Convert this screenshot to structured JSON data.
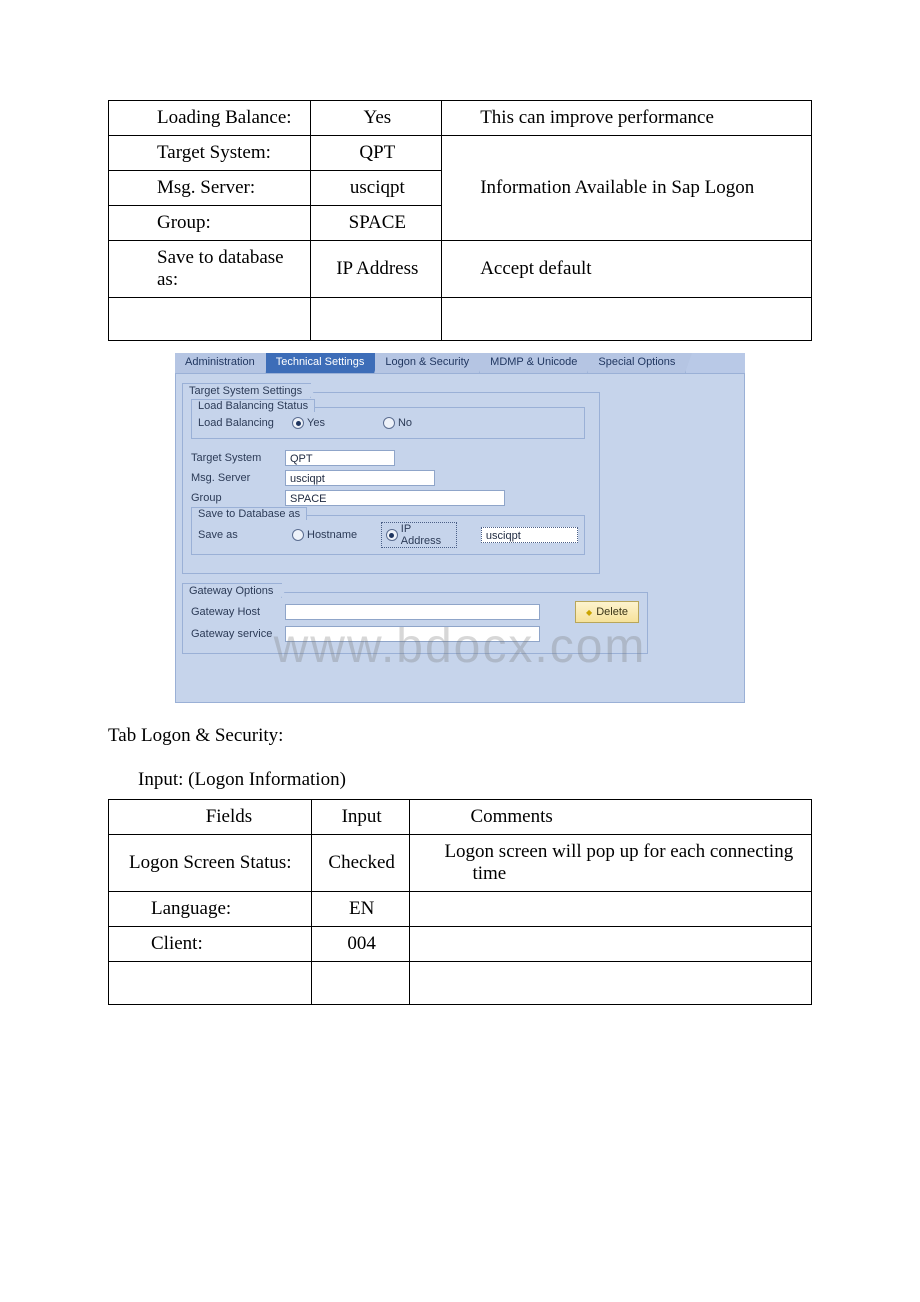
{
  "table1": {
    "rows": [
      {
        "field": "Loading Balance:",
        "input": "Yes",
        "comment": "This can improve performance"
      },
      {
        "field": "Target System:",
        "input": "QPT",
        "comment": "Information Available in Sap Logon"
      },
      {
        "field": "Msg. Server:",
        "input": "usciqpt"
      },
      {
        "field": "Group:",
        "input": "SPACE"
      },
      {
        "field": "Save to database as:",
        "input": "IP Address",
        "comment": "Accept default"
      }
    ]
  },
  "sap": {
    "tabs": {
      "admin": "Administration",
      "tech": "Technical Settings",
      "logon": "Logon & Security",
      "mdmp": "MDMP & Unicode",
      "spec": "Special Options"
    },
    "targetGroupTitle": "Target System Settings",
    "lbSubTitle": "Load Balancing Status",
    "lbLabel": "Load Balancing",
    "lbYes": "Yes",
    "lbNo": "No",
    "targetSystemLabel": "Target System",
    "targetSystemVal": "QPT",
    "msgServerLabel": "Msg. Server",
    "msgServerVal": "usciqpt",
    "groupLabel": "Group",
    "groupVal": "SPACE",
    "saveDbSubTitle": "Save to Database as",
    "saveAsLabel": "Save as",
    "hostnameOpt": "Hostname",
    "ipOpt": "IP Address",
    "ipVal": "usciqpt",
    "gwGroupTitle": "Gateway Options",
    "gwHostLabel": "Gateway Host",
    "gwServiceLabel": "Gateway service",
    "deleteBtn": "Delete",
    "watermark": "www.bdocx.com"
  },
  "para": {
    "p1": "Tab Logon & Security:",
    "p2": "Input: (Logon Information)"
  },
  "table2": {
    "head": {
      "field": "Fields",
      "input": "Input",
      "comment": "Comments"
    },
    "rows": [
      {
        "field": "Logon Screen Status:",
        "input": "Checked",
        "comment": "Logon screen will pop up for each connecting time"
      },
      {
        "field": "Language:",
        "input": "EN",
        "comment": ""
      },
      {
        "field": "Client:",
        "input": "004",
        "comment": ""
      }
    ]
  }
}
